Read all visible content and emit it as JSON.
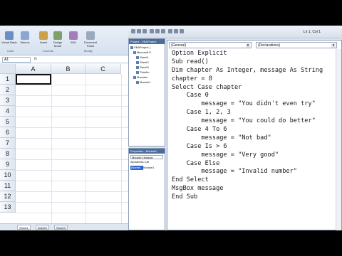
{
  "excel": {
    "ribbon": {
      "buttons": [
        {
          "label": "Visual Basic",
          "icon": "visual-basic-icon"
        },
        {
          "label": "Macros",
          "icon": "macros-icon"
        },
        {
          "label": "Insert",
          "icon": "insert-icon"
        },
        {
          "label": "Design Mode",
          "icon": "design-mode-icon"
        },
        {
          "label": "XML",
          "icon": "xml-icon"
        },
        {
          "label": "Document Panel",
          "icon": "document-panel-icon"
        }
      ],
      "groups": [
        "Code",
        "Controls",
        "Modify"
      ]
    },
    "name_box": "A1",
    "fx": "fx",
    "columns": [
      "A",
      "B",
      "C"
    ],
    "rows": [
      "1",
      "2",
      "3",
      "4",
      "5",
      "6",
      "7",
      "8",
      "9",
      "10",
      "11",
      "12",
      "13"
    ],
    "sheet_tabs": [
      "Sheet1",
      "Sheet2",
      "Sheet3"
    ]
  },
  "vbe": {
    "position": "Ln 1, Col 1",
    "project_title": "Project - VBAProject",
    "tree": [
      "VBAProject (",
      "Microsoft E",
      "Sheet1",
      "Sheet2",
      "Sheet3",
      "ThisWo",
      "Modules",
      "Module1"
    ],
    "properties_title": "Properties - Module1",
    "properties_select": "Module1 Module",
    "properties_tabs": "Alphabetic  Cat",
    "properties_row": {
      "key": "(Name)",
      "value": "Module1"
    },
    "object_combo": "(General)",
    "proc_combo": "(Declarations)",
    "code_lines": [
      "Option Explicit",
      "Sub read()",
      "Dim chapter As Integer, message As String",
      "chapter = 8",
      "Select Case chapter",
      "    Case 0",
      "        message = \"You didn't even try\"",
      "    Case 1, 2, 3",
      "        message = \"You could do better\"",
      "    Case 4 To 6",
      "        message = \"Not bad\"",
      "    Case Is > 6",
      "        message = \"Very good\"",
      "    Case Else",
      "        message = \"Invalid number\"",
      "End Select",
      "MsgBox message",
      "End Sub"
    ]
  },
  "colors": {
    "accent": "#4a6d9c",
    "selection": "#3366cc"
  }
}
